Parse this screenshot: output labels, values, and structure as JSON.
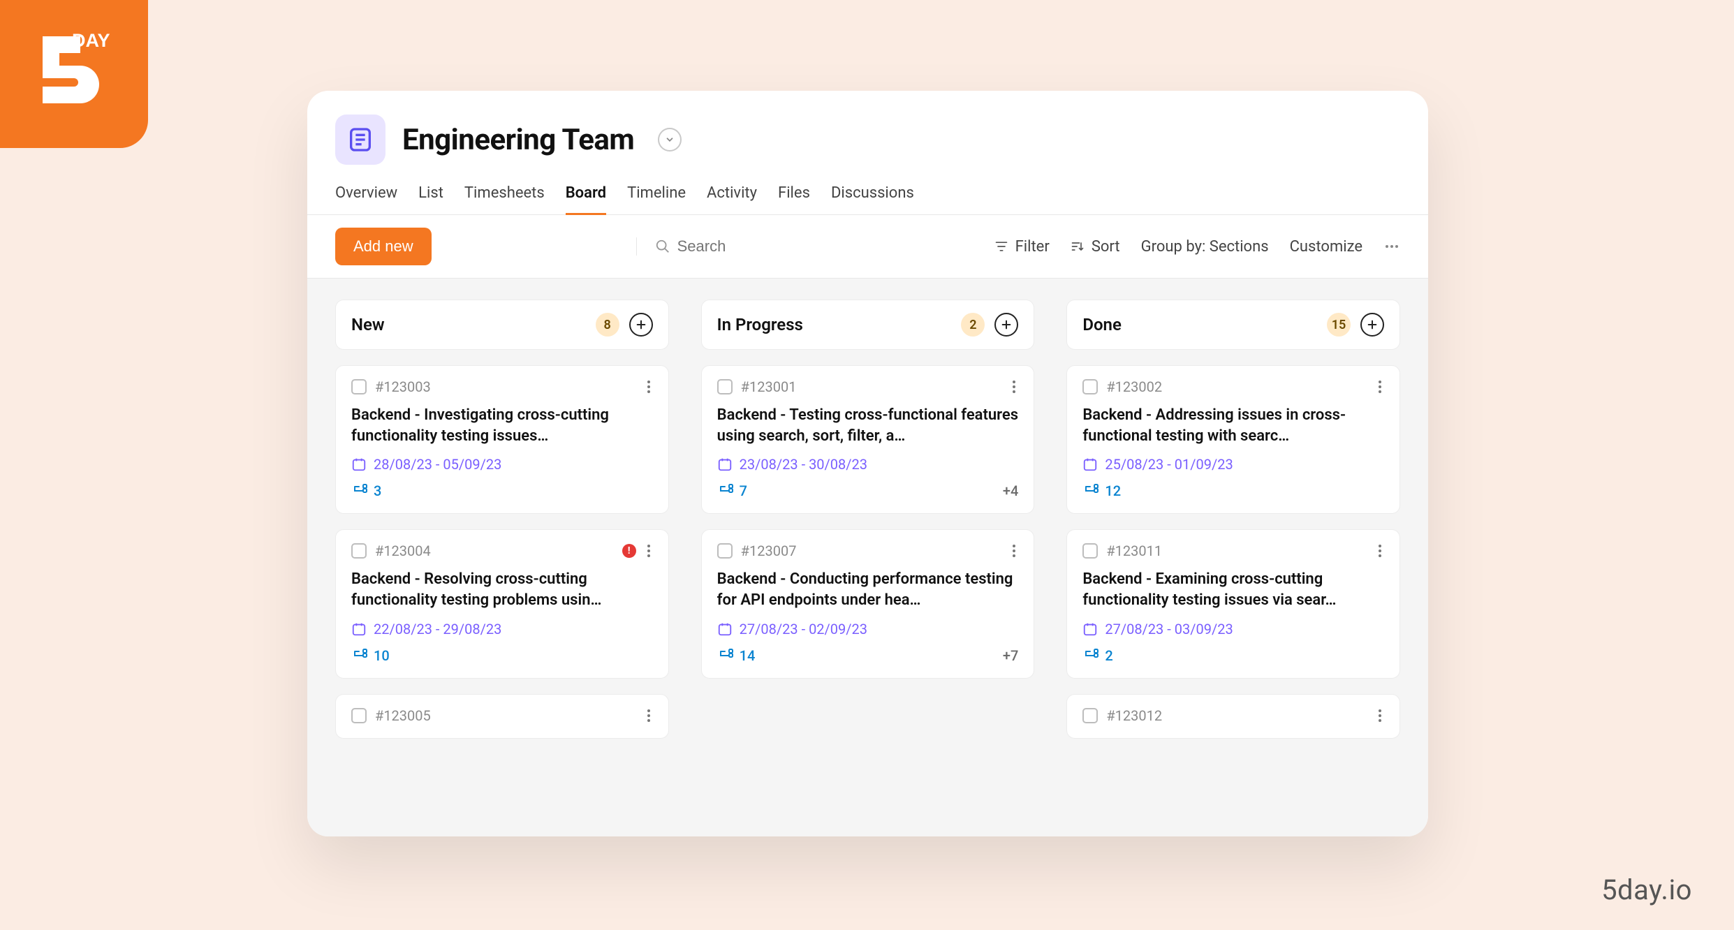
{
  "brand": {
    "name": "5DAY",
    "watermark": "5day.io"
  },
  "header": {
    "title": "Engineering Team"
  },
  "tabs": [
    "Overview",
    "List",
    "Timesheets",
    "Board",
    "Timeline",
    "Activity",
    "Files",
    "Discussions"
  ],
  "active_tab": "Board",
  "toolbar": {
    "add_label": "Add new",
    "search_placeholder": "Search",
    "filter_label": "Filter",
    "sort_label": "Sort",
    "group_by_label": "Group by: Sections",
    "customize_label": "Customize"
  },
  "columns": [
    {
      "title": "New",
      "count": "8",
      "cards": [
        {
          "id": "#123003",
          "title": "Backend - Investigating cross-cutting functionality testing issues…",
          "dates": "28/08/23 - 05/09/23",
          "subtasks": "3",
          "alert": false,
          "extra": ""
        },
        {
          "id": "#123004",
          "title": "Backend - Resolving cross-cutting functionality testing problems usin…",
          "dates": "22/08/23 - 29/08/23",
          "subtasks": "10",
          "alert": true,
          "extra": ""
        },
        {
          "id": "#123005",
          "title": "",
          "dates": "",
          "subtasks": "",
          "alert": false,
          "extra": "",
          "stub": true
        }
      ]
    },
    {
      "title": "In Progress",
      "count": "2",
      "cards": [
        {
          "id": "#123001",
          "title": "Backend - Testing cross-functional features using search, sort, filter, a…",
          "dates": "23/08/23 - 30/08/23",
          "subtasks": "7",
          "alert": false,
          "extra": "+4"
        },
        {
          "id": "#123007",
          "title": "Backend - Conducting performance testing for API endpoints under hea…",
          "dates": "27/08/23 - 02/09/23",
          "subtasks": "14",
          "alert": false,
          "extra": "+7"
        }
      ]
    },
    {
      "title": "Done",
      "count": "15",
      "cards": [
        {
          "id": "#123002",
          "title": "Backend - Addressing issues in cross-functional testing with searc…",
          "dates": "25/08/23 - 01/09/23",
          "subtasks": "12",
          "alert": false,
          "extra": ""
        },
        {
          "id": "#123011",
          "title": "Backend - Examining cross-cutting functionality testing issues via sear…",
          "dates": "27/08/23 - 03/09/23",
          "subtasks": "2",
          "alert": false,
          "extra": ""
        },
        {
          "id": "#123012",
          "title": "",
          "dates": "",
          "subtasks": "",
          "alert": false,
          "extra": "",
          "stub": true
        }
      ]
    }
  ]
}
